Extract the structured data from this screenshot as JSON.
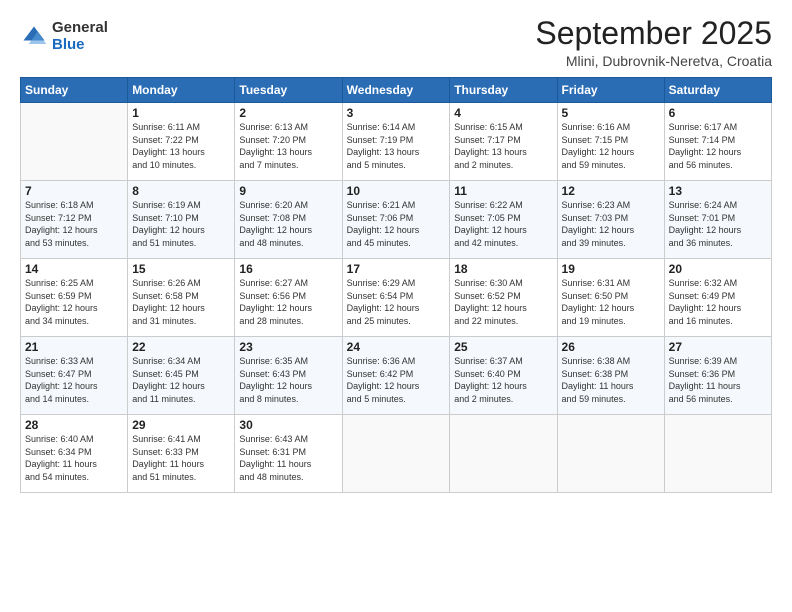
{
  "header": {
    "logo": {
      "general": "General",
      "blue": "Blue"
    },
    "title": "September 2025",
    "location": "Mlini, Dubrovnik-Neretva, Croatia"
  },
  "columns": [
    "Sunday",
    "Monday",
    "Tuesday",
    "Wednesday",
    "Thursday",
    "Friday",
    "Saturday"
  ],
  "weeks": [
    [
      {
        "day": "",
        "info": ""
      },
      {
        "day": "1",
        "info": "Sunrise: 6:11 AM\nSunset: 7:22 PM\nDaylight: 13 hours\nand 10 minutes."
      },
      {
        "day": "2",
        "info": "Sunrise: 6:13 AM\nSunset: 7:20 PM\nDaylight: 13 hours\nand 7 minutes."
      },
      {
        "day": "3",
        "info": "Sunrise: 6:14 AM\nSunset: 7:19 PM\nDaylight: 13 hours\nand 5 minutes."
      },
      {
        "day": "4",
        "info": "Sunrise: 6:15 AM\nSunset: 7:17 PM\nDaylight: 13 hours\nand 2 minutes."
      },
      {
        "day": "5",
        "info": "Sunrise: 6:16 AM\nSunset: 7:15 PM\nDaylight: 12 hours\nand 59 minutes."
      },
      {
        "day": "6",
        "info": "Sunrise: 6:17 AM\nSunset: 7:14 PM\nDaylight: 12 hours\nand 56 minutes."
      }
    ],
    [
      {
        "day": "7",
        "info": "Sunrise: 6:18 AM\nSunset: 7:12 PM\nDaylight: 12 hours\nand 53 minutes."
      },
      {
        "day": "8",
        "info": "Sunrise: 6:19 AM\nSunset: 7:10 PM\nDaylight: 12 hours\nand 51 minutes."
      },
      {
        "day": "9",
        "info": "Sunrise: 6:20 AM\nSunset: 7:08 PM\nDaylight: 12 hours\nand 48 minutes."
      },
      {
        "day": "10",
        "info": "Sunrise: 6:21 AM\nSunset: 7:06 PM\nDaylight: 12 hours\nand 45 minutes."
      },
      {
        "day": "11",
        "info": "Sunrise: 6:22 AM\nSunset: 7:05 PM\nDaylight: 12 hours\nand 42 minutes."
      },
      {
        "day": "12",
        "info": "Sunrise: 6:23 AM\nSunset: 7:03 PM\nDaylight: 12 hours\nand 39 minutes."
      },
      {
        "day": "13",
        "info": "Sunrise: 6:24 AM\nSunset: 7:01 PM\nDaylight: 12 hours\nand 36 minutes."
      }
    ],
    [
      {
        "day": "14",
        "info": "Sunrise: 6:25 AM\nSunset: 6:59 PM\nDaylight: 12 hours\nand 34 minutes."
      },
      {
        "day": "15",
        "info": "Sunrise: 6:26 AM\nSunset: 6:58 PM\nDaylight: 12 hours\nand 31 minutes."
      },
      {
        "day": "16",
        "info": "Sunrise: 6:27 AM\nSunset: 6:56 PM\nDaylight: 12 hours\nand 28 minutes."
      },
      {
        "day": "17",
        "info": "Sunrise: 6:29 AM\nSunset: 6:54 PM\nDaylight: 12 hours\nand 25 minutes."
      },
      {
        "day": "18",
        "info": "Sunrise: 6:30 AM\nSunset: 6:52 PM\nDaylight: 12 hours\nand 22 minutes."
      },
      {
        "day": "19",
        "info": "Sunrise: 6:31 AM\nSunset: 6:50 PM\nDaylight: 12 hours\nand 19 minutes."
      },
      {
        "day": "20",
        "info": "Sunrise: 6:32 AM\nSunset: 6:49 PM\nDaylight: 12 hours\nand 16 minutes."
      }
    ],
    [
      {
        "day": "21",
        "info": "Sunrise: 6:33 AM\nSunset: 6:47 PM\nDaylight: 12 hours\nand 14 minutes."
      },
      {
        "day": "22",
        "info": "Sunrise: 6:34 AM\nSunset: 6:45 PM\nDaylight: 12 hours\nand 11 minutes."
      },
      {
        "day": "23",
        "info": "Sunrise: 6:35 AM\nSunset: 6:43 PM\nDaylight: 12 hours\nand 8 minutes."
      },
      {
        "day": "24",
        "info": "Sunrise: 6:36 AM\nSunset: 6:42 PM\nDaylight: 12 hours\nand 5 minutes."
      },
      {
        "day": "25",
        "info": "Sunrise: 6:37 AM\nSunset: 6:40 PM\nDaylight: 12 hours\nand 2 minutes."
      },
      {
        "day": "26",
        "info": "Sunrise: 6:38 AM\nSunset: 6:38 PM\nDaylight: 11 hours\nand 59 minutes."
      },
      {
        "day": "27",
        "info": "Sunrise: 6:39 AM\nSunset: 6:36 PM\nDaylight: 11 hours\nand 56 minutes."
      }
    ],
    [
      {
        "day": "28",
        "info": "Sunrise: 6:40 AM\nSunset: 6:34 PM\nDaylight: 11 hours\nand 54 minutes."
      },
      {
        "day": "29",
        "info": "Sunrise: 6:41 AM\nSunset: 6:33 PM\nDaylight: 11 hours\nand 51 minutes."
      },
      {
        "day": "30",
        "info": "Sunrise: 6:43 AM\nSunset: 6:31 PM\nDaylight: 11 hours\nand 48 minutes."
      },
      {
        "day": "",
        "info": ""
      },
      {
        "day": "",
        "info": ""
      },
      {
        "day": "",
        "info": ""
      },
      {
        "day": "",
        "info": ""
      }
    ]
  ]
}
